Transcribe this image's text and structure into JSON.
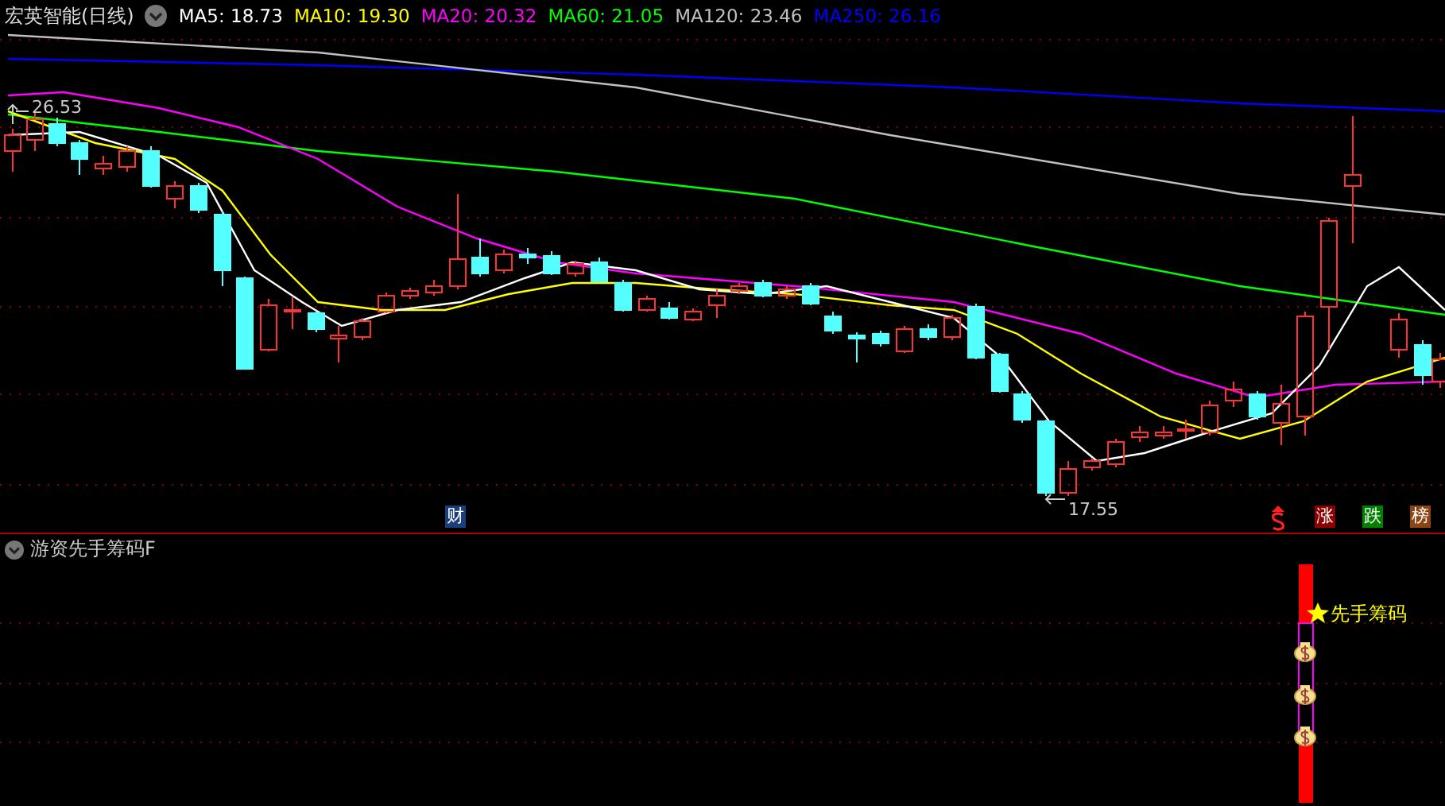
{
  "header": {
    "title": "宏英智能(日线)",
    "indicators": [
      {
        "label": "MA5: 18.73",
        "color": "#ffffff"
      },
      {
        "label": "MA10: 19.30",
        "color": "#ffff00"
      },
      {
        "label": "MA20: 20.32",
        "color": "#ff00ff"
      },
      {
        "label": "MA60: 21.05",
        "color": "#00ff00"
      },
      {
        "label": "MA120: 23.46",
        "color": "#c0c0c0"
      },
      {
        "label": "MA250: 26.16",
        "color": "#0000ff"
      }
    ]
  },
  "price_chart": {
    "high_label": "26.53",
    "low_label": "17.55",
    "markers": [
      {
        "text": "财",
        "color": "#1c3f7c"
      },
      {
        "text": "涨",
        "color": "#8b0000"
      },
      {
        "text": "跌",
        "color": "#008000"
      },
      {
        "text": "榜",
        "color": "#8b4513"
      }
    ]
  },
  "indicator_panel": {
    "title": "游资先手筹码F",
    "signal_label": "先手筹码"
  }
}
